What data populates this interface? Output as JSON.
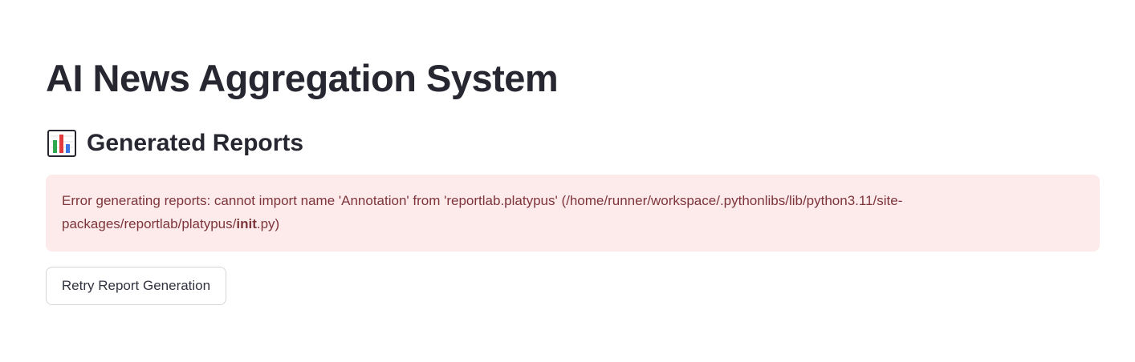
{
  "page": {
    "title": "AI News Aggregation System"
  },
  "reports": {
    "icon": "bar-chart-icon",
    "heading": "Generated Reports",
    "error": {
      "prefix": "Error generating reports: cannot import name 'Annotation' from 'reportlab.platypus' (/home/runner/workspace/.pythonlibs/lib/python3.11/site-packages/reportlab/platypus/",
      "bold": "init",
      "suffix": ".py)"
    },
    "retry_label": "Retry Report Generation"
  },
  "colors": {
    "title": "#262730",
    "alert_background": "#fdebec",
    "alert_text": "#7d353b",
    "button_border": "#d5d6dc"
  }
}
